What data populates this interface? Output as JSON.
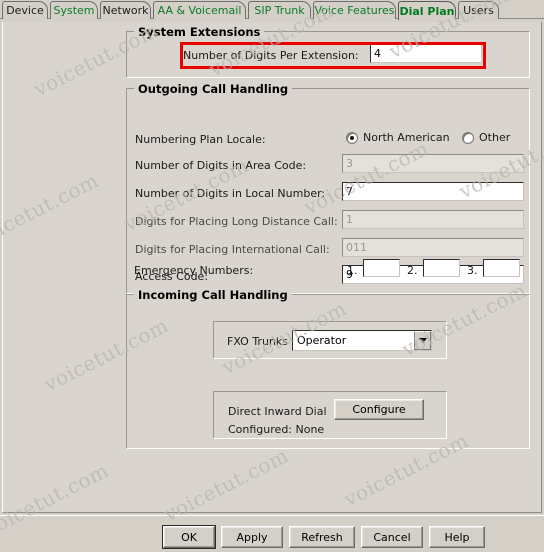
{
  "window": {
    "background_color": "#d4d0c8",
    "accent_highlight_color": "#e60000",
    "tab_text_color": "#0a7a28"
  },
  "tabs": [
    {
      "label": "Device",
      "active": false,
      "style": "dark"
    },
    {
      "label": "System",
      "active": false,
      "style": "green"
    },
    {
      "label": "Network",
      "active": false,
      "style": "dark"
    },
    {
      "label": "AA & Voicemail",
      "active": false,
      "style": "green"
    },
    {
      "label": "SIP Trunk",
      "active": false,
      "style": "green"
    },
    {
      "label": "Voice Features",
      "active": false,
      "style": "green"
    },
    {
      "label": "Dial Plan",
      "active": true,
      "style": "green"
    },
    {
      "label": "Users",
      "active": false,
      "style": "dark"
    }
  ],
  "system_extensions": {
    "title": "System Extensions",
    "digits_per_extension": {
      "label": "Number of Digits Per Extension:",
      "value": "4",
      "highlighted": true
    }
  },
  "outgoing_call_handling": {
    "title": "Outgoing Call Handling",
    "numbering_plan_locale": {
      "label": "Numbering Plan Locale:",
      "options": [
        {
          "label": "North American",
          "selected": true
        },
        {
          "label": "Other",
          "selected": false
        }
      ]
    },
    "fields": [
      {
        "label": "Number of Digits in Area Code:",
        "value": "3",
        "enabled": false
      },
      {
        "label": "Number of Digits in Local Number:",
        "value": "7",
        "enabled": true
      },
      {
        "label": "Digits for Placing Long Distance Call:",
        "value": "1",
        "enabled": false
      },
      {
        "label": "Digits for Placing International Call:",
        "value": "011",
        "enabled": false
      },
      {
        "label": "Access Code:",
        "value": "9",
        "enabled": true
      }
    ],
    "emergency_numbers": {
      "label": "Emergency Numbers:",
      "entries": [
        {
          "index": "1.",
          "value": ""
        },
        {
          "index": "2.",
          "value": ""
        },
        {
          "index": "3.",
          "value": ""
        }
      ]
    }
  },
  "incoming_call_handling": {
    "title": "Incoming Call Handling",
    "fxo_trunks": {
      "label": "FXO Trunks",
      "selected": "Operator",
      "dropdown_icon": "chevron-down-icon"
    },
    "direct_inward_dial": {
      "label": "Direct Inward Dial",
      "configure_button": "Configure",
      "status": "Configured: None"
    }
  },
  "bottom_buttons": [
    {
      "label": "OK",
      "default": true
    },
    {
      "label": "Apply",
      "default": false
    },
    {
      "label": "Refresh",
      "default": false
    },
    {
      "label": "Cancel",
      "default": false
    },
    {
      "label": "Help",
      "default": false
    }
  ],
  "watermark": {
    "text": "voicetut.com"
  }
}
